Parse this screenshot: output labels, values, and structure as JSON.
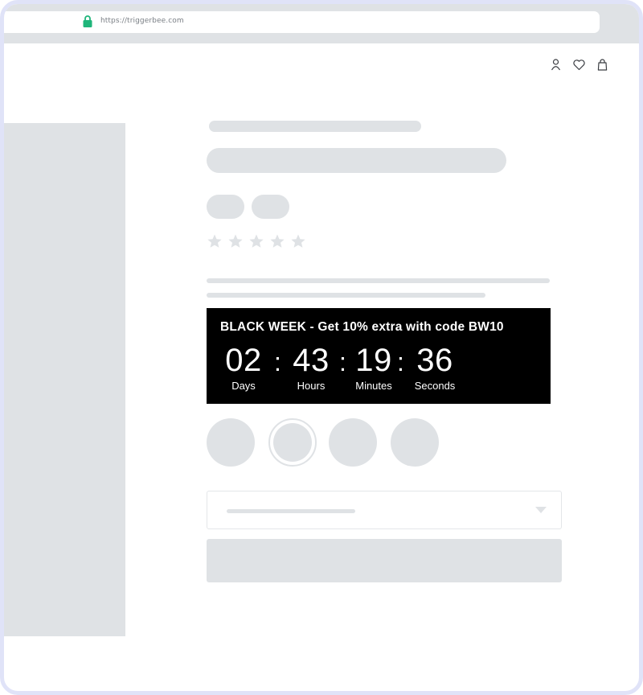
{
  "browser": {
    "url": "https://triggerbee.com",
    "lock_icon": "lock-icon"
  },
  "header": {
    "icons": [
      "user-icon",
      "heart-icon",
      "bag-icon"
    ]
  },
  "product": {
    "rating_icons": [
      "star-icon",
      "star-icon",
      "star-icon",
      "star-icon",
      "star-icon"
    ]
  },
  "countdown": {
    "headline": "BLACK WEEK - Get 10% extra with code BW10",
    "separator": ":",
    "units": [
      {
        "value": "02",
        "label": "Days"
      },
      {
        "value": "43",
        "label": "Hours"
      },
      {
        "value": "19",
        "label": "Minutes"
      },
      {
        "value": "36",
        "label": "Seconds"
      }
    ],
    "background": "#000000",
    "text_color": "#ffffff"
  },
  "colors": {
    "placeholder": "#dfe2e5",
    "frame_border": "#e0e3f8",
    "lock_green": "#1fb57a"
  }
}
